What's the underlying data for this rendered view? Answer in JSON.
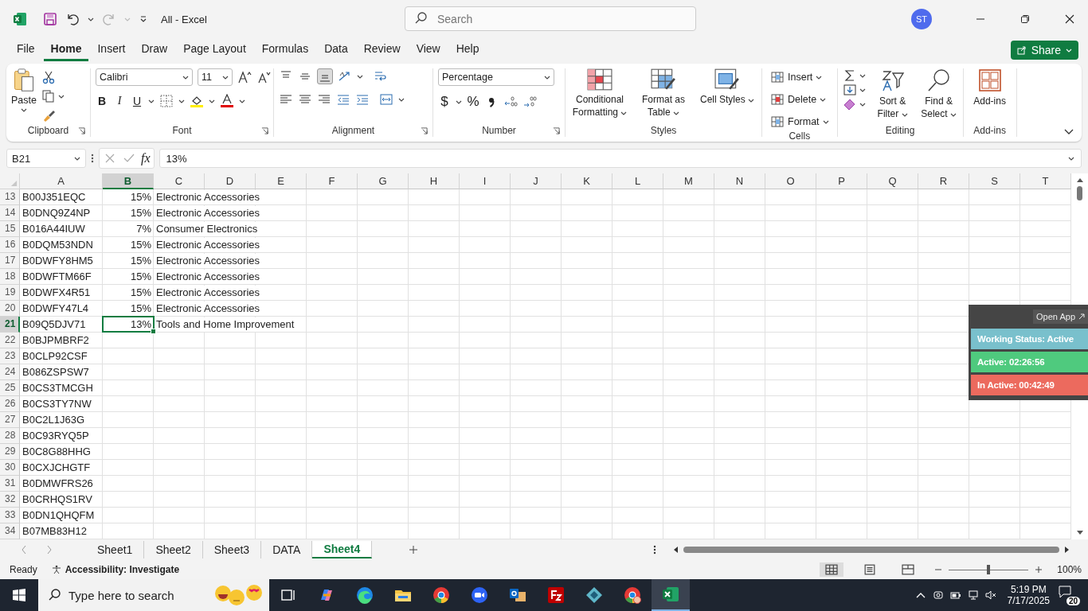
{
  "title_bar": {
    "document_title": "All  -  Excel",
    "search_placeholder": "Search",
    "avatar": "ST"
  },
  "menu_tabs": [
    {
      "label": "File",
      "selected": false
    },
    {
      "label": "Home",
      "selected": true
    },
    {
      "label": "Insert",
      "selected": false
    },
    {
      "label": "Draw",
      "selected": false
    },
    {
      "label": "Page Layout",
      "selected": false
    },
    {
      "label": "Formulas",
      "selected": false
    },
    {
      "label": "Data",
      "selected": false
    },
    {
      "label": "Review",
      "selected": false
    },
    {
      "label": "View",
      "selected": false
    },
    {
      "label": "Help",
      "selected": false
    }
  ],
  "share": "Share",
  "ribbon": {
    "clipboard": {
      "paste": "Paste",
      "label": "Clipboard"
    },
    "font": {
      "family": "Calibri",
      "size": "11",
      "bold": "B",
      "italic": "I",
      "underline": "U",
      "label": "Font"
    },
    "alignment": {
      "label": "Alignment"
    },
    "number": {
      "format": "Percentage",
      "currency": "$",
      "percent": "%",
      "label": "Number"
    },
    "styles": {
      "buttons": [
        "Conditional Formatting",
        "Format as Table",
        "Cell Styles"
      ],
      "label": "Styles"
    },
    "cells": {
      "buttons": [
        "Insert",
        "Delete",
        "Format"
      ],
      "label": "Cells"
    },
    "editing": {
      "buttons": [
        "Sort & Filter",
        "Find & Select"
      ],
      "label": "Editing"
    },
    "addins": {
      "button": "Add-ins",
      "label": "Add-ins"
    }
  },
  "formula_bar": {
    "name_box": "B21",
    "fx": "fx",
    "formula": "13%"
  },
  "columns": [
    {
      "label": "A",
      "selected": false
    },
    {
      "label": "B",
      "selected": true
    },
    {
      "label": "C",
      "selected": false
    },
    {
      "label": "D",
      "selected": false
    },
    {
      "label": "E",
      "selected": false
    },
    {
      "label": "F",
      "selected": false
    },
    {
      "label": "G",
      "selected": false
    },
    {
      "label": "H",
      "selected": false
    },
    {
      "label": "I",
      "selected": false
    },
    {
      "label": "J",
      "selected": false
    },
    {
      "label": "K",
      "selected": false
    },
    {
      "label": "L",
      "selected": false
    },
    {
      "label": "M",
      "selected": false
    },
    {
      "label": "N",
      "selected": false
    },
    {
      "label": "O",
      "selected": false
    },
    {
      "label": "P",
      "selected": false
    },
    {
      "label": "Q",
      "selected": false
    },
    {
      "label": "R",
      "selected": false
    },
    {
      "label": "S",
      "selected": false
    },
    {
      "label": "T",
      "selected": false
    }
  ],
  "rows": [
    {
      "number": "13",
      "a": "B00J351EQC",
      "b": "15%",
      "c": "Electronic Accessories",
      "selected": false
    },
    {
      "number": "14",
      "a": "B0DNQ9Z4NP",
      "b": "15%",
      "c": "Electronic Accessories",
      "selected": false
    },
    {
      "number": "15",
      "a": "B016A44IUW",
      "b": "7%",
      "c": "Consumer Electronics",
      "selected": false
    },
    {
      "number": "16",
      "a": "B0DQM53NDN",
      "b": "15%",
      "c": "Electronic Accessories",
      "selected": false
    },
    {
      "number": "17",
      "a": "B0DWFY8HM5",
      "b": "15%",
      "c": "Electronic Accessories",
      "selected": false
    },
    {
      "number": "18",
      "a": "B0DWFTM66F",
      "b": "15%",
      "c": "Electronic Accessories",
      "selected": false
    },
    {
      "number": "19",
      "a": "B0DWFX4R51",
      "b": "15%",
      "c": "Electronic Accessories",
      "selected": false
    },
    {
      "number": "20",
      "a": "B0DWFY47L4",
      "b": "15%",
      "c": "Electronic Accessories",
      "selected": false
    },
    {
      "number": "21",
      "a": "B09Q5DJV71",
      "b": "13%",
      "c": "Tools and Home Improvement",
      "selected": true
    },
    {
      "number": "22",
      "a": "B0BJPMBRF2",
      "selected": false
    },
    {
      "number": "23",
      "a": "B0CLP92CSF",
      "selected": false
    },
    {
      "number": "24",
      "a": "B086ZSPSW7",
      "selected": false
    },
    {
      "number": "25",
      "a": "B0CS3TMCGH",
      "selected": false
    },
    {
      "number": "26",
      "a": "B0CS3TY7NW",
      "selected": false
    },
    {
      "number": "27",
      "a": "B0C2L1J63G",
      "selected": false
    },
    {
      "number": "28",
      "a": "B0C93RYQ5P",
      "selected": false
    },
    {
      "number": "29",
      "a": "B0C8G88HHG",
      "selected": false
    },
    {
      "number": "30",
      "a": "B0CXJCHGTF",
      "selected": false
    },
    {
      "number": "31",
      "a": "B0DMWFRS26",
      "selected": false
    },
    {
      "number": "32",
      "a": "B0CRHQS1RV",
      "selected": false
    },
    {
      "number": "33",
      "a": "B0DN1QHQFM",
      "selected": false
    },
    {
      "number": "34",
      "a": "B07MB83H12",
      "selected": false
    }
  ],
  "tracker": {
    "open_app": "Open App",
    "items": [
      {
        "text": "Working Status: Active",
        "color": "#79c0cc"
      },
      {
        "text": "Active: 02:26:56",
        "color": "#4fca7e"
      },
      {
        "text": "In Active: 00:42:49",
        "color": "#ec6a5e"
      }
    ]
  },
  "sheets": [
    {
      "label": "Sheet1",
      "selected": false
    },
    {
      "label": "Sheet2",
      "selected": false
    },
    {
      "label": "Sheet3",
      "selected": false
    },
    {
      "label": "DATA",
      "selected": false
    },
    {
      "label": "Sheet4",
      "selected": true
    }
  ],
  "status_bar": {
    "ready": "Ready",
    "accessibility": "Accessibility: Investigate",
    "zoom": {
      "level": 0.5
    },
    "zoom_reading": "100%"
  },
  "taskbar": {
    "search_placeholder": "Type here to search",
    "time": "5:19 PM",
    "date": "7/17/2025",
    "notifications": "20"
  }
}
